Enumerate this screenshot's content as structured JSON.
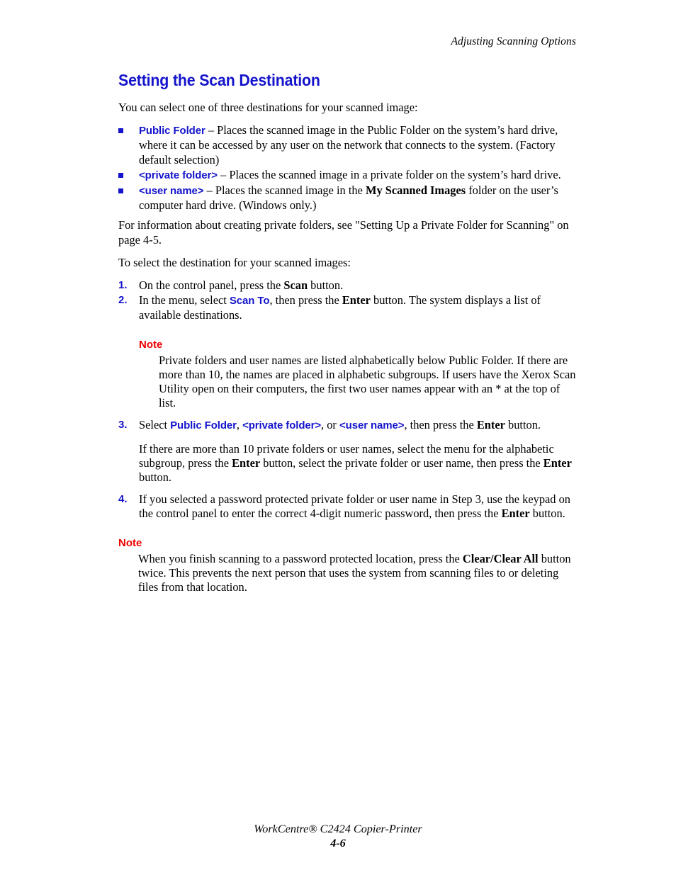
{
  "header": {
    "running_head": "Adjusting Scanning Options"
  },
  "colors": {
    "accent_blue": "#1414CC",
    "note_red": "#EE0000",
    "text_black": "#000000",
    "page_background": "#FFFFFF"
  },
  "main": {
    "title": "Setting the Scan Destination",
    "intro": "You can select one of three destinations for your scanned image:",
    "bullets": [
      {
        "term": "Public Folder",
        "text": " – Places the scanned image in the Public Folder on the system’s hard drive, where it can be accessed by any user on the network that connects to the system. (Factory default selection)"
      },
      {
        "term": "<private folder>",
        "text": " – Places the scanned image in a private folder on the system’s hard drive."
      },
      {
        "term": "<user name>",
        "text_before": " – Places the scanned image in the ",
        "bold_term": "My Scanned Images",
        "text_after": " folder on the user’s computer hard drive. (Windows only.)"
      }
    ],
    "cross_reference": "For information about creating private folders, see \"Setting Up a Private Folder for Scanning\" on page 4-5.",
    "lead_in": "To select the destination for your scanned images:",
    "steps": [
      {
        "number": "1.",
        "text_before": "On the control panel, press the ",
        "bold_term": "Scan",
        "text_after": " button."
      },
      {
        "number": "2.",
        "text_before": "In the menu, select ",
        "ui_term": "Scan To",
        "text_middle": ", then press the ",
        "bold_term": "Enter",
        "text_after": " button. The system displays a list of available destinations."
      },
      {
        "number": "3.",
        "text_before": "Select ",
        "ui_term_1": "Public Folder",
        "text_sep_1": ", ",
        "ui_term_2": "<private folder>",
        "text_sep_2": ", or ",
        "ui_term_3": "<user name>",
        "text_middle": ", then press the ",
        "bold_term": "Enter",
        "text_after": " button.",
        "sub_paragraph": {
          "text_before": "If there are more than 10 private folders or user names, select the menu for the alphabetic subgroup, press the ",
          "bold_term_1": "Enter",
          "text_middle": " button, select the private folder or user name, then press the ",
          "bold_term_2": "Enter",
          "text_after": " button."
        }
      },
      {
        "number": "4.",
        "text_before": "If you selected a password protected private folder or user name in Step 3, use the keypad on the control panel to enter the correct 4-digit numeric password, then press the ",
        "bold_term": "Enter",
        "text_after": " button."
      }
    ],
    "notes": [
      {
        "label": "Note",
        "body": "Private folders and user names are listed alphabetically below Public Folder. If there are more than 10, the names are placed in alphabetic subgroups. If users have the Xerox Scan Utility open on their computers, the first two user names appear with an * at the top of list."
      },
      {
        "label": "Note",
        "text_before": "When you finish scanning to a password protected location, press the ",
        "bold_term": "Clear/Clear All",
        "text_after": " button twice. This prevents the next person that uses the system from scanning files to or deleting files from that location."
      }
    ]
  },
  "footer": {
    "product": "WorkCentre® C2424 Copier-Printer",
    "page_number": "4-6"
  }
}
